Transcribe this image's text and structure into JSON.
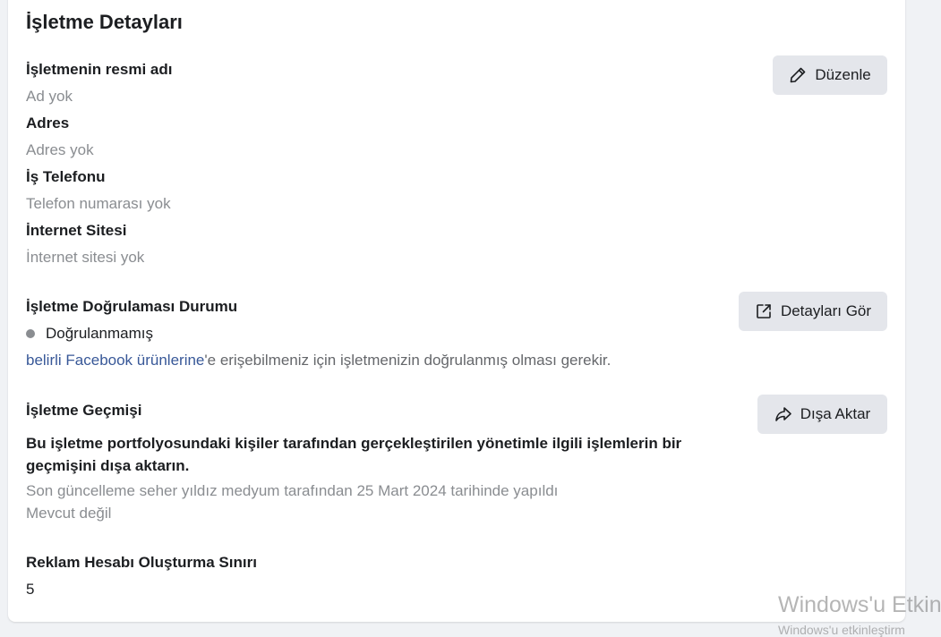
{
  "title": "İşletme Detayları",
  "details": {
    "official_name_label": "İşletmenin resmi adı",
    "official_name_value": "Ad yok",
    "address_label": "Adres",
    "address_value": "Adres yok",
    "phone_label": "İş Telefonu",
    "phone_value": "Telefon numarası yok",
    "website_label": "İnternet Sitesi",
    "website_value": "İnternet sitesi yok",
    "edit_button": "Düzenle"
  },
  "verification": {
    "label": "İşletme Doğrulaması Durumu",
    "status": "Doğrulanmamış",
    "status_color": "#8a8d91",
    "note_link": "belirli Facebook ürünlerine",
    "note_rest": "'e erişebilmeniz için işletmenizin doğrulanmış olması gerekir.",
    "details_button": "Detayları Gör"
  },
  "history": {
    "label": "İşletme Geçmişi",
    "description": "Bu işletme portfolyosundaki kişiler tarafından gerçekleştirilen yönetimle ilgili işlemlerin bir geçmişini dışa aktarın.",
    "last_update": "Son güncelleme seher yıldız medyum tarafından 25 Mart 2024 tarihinde yapıldı",
    "availability": "Mevcut değil",
    "export_button": "Dışa Aktar"
  },
  "ad_account_limit": {
    "label": "Reklam Hesabı Oluşturma Sınırı",
    "value": "5"
  },
  "watermark": {
    "line1": "Windows'u Etkin",
    "line2": "Windows'u etkinleştirm"
  },
  "colors": {
    "link": "#385898",
    "button_bg": "#e4e6eb",
    "muted_text": "#8a8d91"
  }
}
